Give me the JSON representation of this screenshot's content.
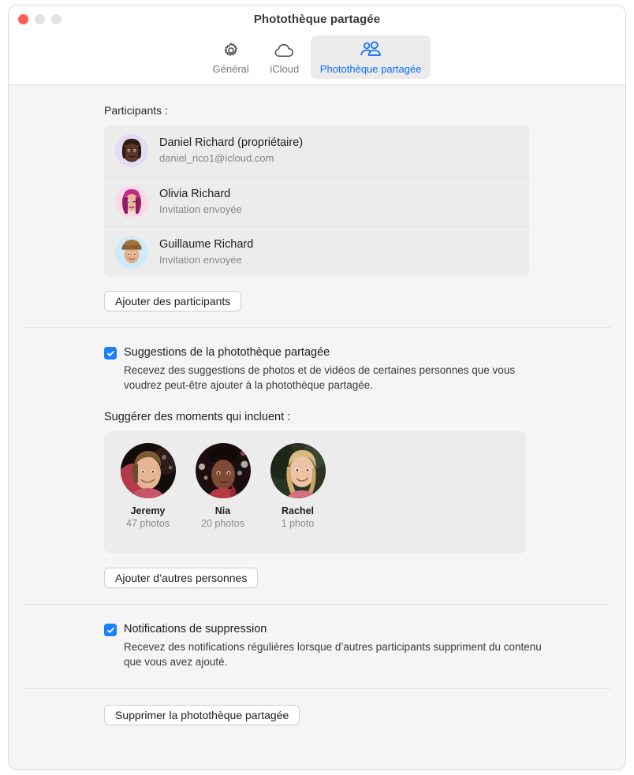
{
  "window": {
    "title": "Photothèque partagée",
    "traffic_lights": [
      "close",
      "minimize",
      "zoom"
    ]
  },
  "toolbar": {
    "tabs": [
      {
        "label": "Général",
        "icon": "gear-icon",
        "selected": false
      },
      {
        "label": "iCloud",
        "icon": "cloud-icon",
        "selected": false
      },
      {
        "label": "Photothèque partagée",
        "icon": "two-people-icon",
        "selected": true
      }
    ],
    "accent_color": "#0a6cff",
    "selected_tab_bg": "#ebebeb"
  },
  "participants_section": {
    "label": "Participants :",
    "rows": [
      {
        "name": "Daniel Richard (propriétaire)",
        "sub": "daniel_rico1@icloud.com",
        "avatar": "memoji-daniel",
        "avatar_bg": "#e4dcf7"
      },
      {
        "name": "Olivia Richard",
        "sub": "Invitation envoyée",
        "avatar": "memoji-olivia",
        "avatar_bg": "#fcd9e6"
      },
      {
        "name": "Guillaume Richard",
        "sub": "Invitation envoyée",
        "avatar": "memoji-guillaume",
        "avatar_bg": "#cfeaf9"
      }
    ],
    "add_button": "Ajouter des participants"
  },
  "suggestions_section": {
    "checkbox": {
      "checked": true,
      "title": "Suggestions de la photothèque partagée",
      "description": "Recevez des suggestions de photos et de vidéos de certaines personnes que vous voudrez peut-être ajouter à la photothèque partagée."
    },
    "moments_label": "Suggérer des moments qui incluent :",
    "people": [
      {
        "name": "Jeremy",
        "count": "47 photos",
        "photo": "portrait-jeremy"
      },
      {
        "name": "Nia",
        "count": "20 photos",
        "photo": "portrait-nia"
      },
      {
        "name": "Rachel",
        "count": "1 photo",
        "photo": "portrait-rachel"
      }
    ],
    "add_button": "Ajouter d’autres personnes"
  },
  "notifications_section": {
    "checkbox": {
      "checked": true,
      "title": "Notifications de suppression",
      "description": "Recevez des notifications régulières lorsque d’autres participants suppriment du contenu que vous avez ajouté."
    }
  },
  "footer": {
    "delete_button": "Supprimer la photothèque partagée"
  },
  "colors": {
    "checkbox_blue": "#1b81ff",
    "window_bg": "#f5f5f5",
    "panel_bg": "#ececec",
    "titlebar_bg": "#ffffff",
    "close_red": "#ff5f57",
    "inactive_gray": "#e2e2e2"
  }
}
